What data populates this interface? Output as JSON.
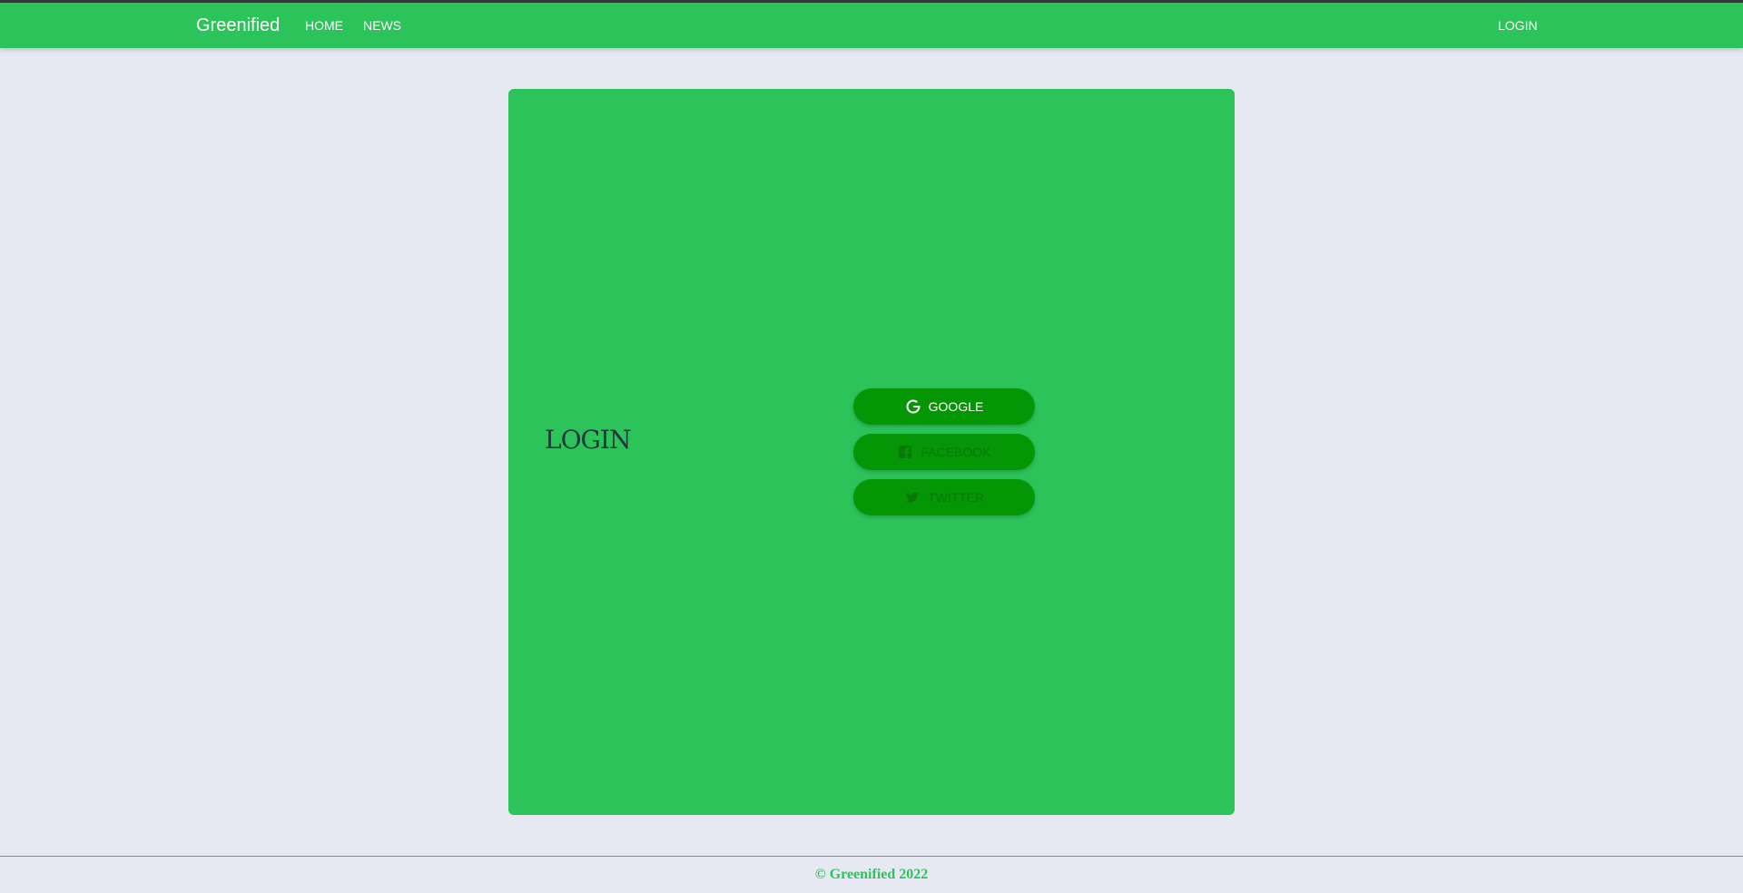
{
  "navbar": {
    "brand": "Greenified",
    "links": [
      "HOME",
      "NEWS"
    ],
    "login": "LOGIN",
    "color": "#2cc35a"
  },
  "card": {
    "title": "LOGIN",
    "buttons": [
      {
        "label": "GOOGLE",
        "icon": "google-icon"
      },
      {
        "label": "FACEBOOK",
        "icon": "facebook-icon"
      },
      {
        "label": "TWITTER",
        "icon": "twitter-icon"
      }
    ],
    "button_color": "#059605"
  },
  "footer": {
    "text": "© Greenified 2022"
  }
}
